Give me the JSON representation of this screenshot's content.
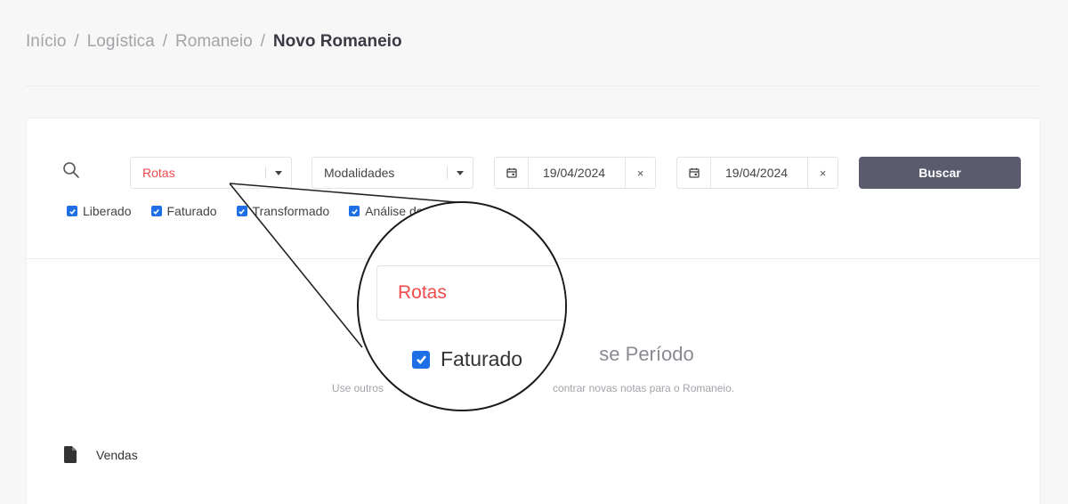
{
  "breadcrumb": {
    "items": [
      "Início",
      "Logística",
      "Romaneio"
    ],
    "separator": "/",
    "current": "Novo Romaneio"
  },
  "filters": {
    "rotas": {
      "value": "Rotas",
      "color": "#f04a4a"
    },
    "modalidades": {
      "value": "Modalidades"
    },
    "date_start": {
      "value": "19/04/2024",
      "clear": "×"
    },
    "date_end": {
      "value": "19/04/2024",
      "clear": "×"
    },
    "search_button": "Buscar",
    "checkboxes": [
      {
        "label": "Liberado",
        "checked": true
      },
      {
        "label": "Faturado",
        "checked": true
      },
      {
        "label": "Transformado",
        "checked": true
      },
      {
        "label": "Análise de",
        "checked": true
      }
    ]
  },
  "empty_state": {
    "title_fragment": "se Período",
    "subtitle_left": "Use outros",
    "subtitle_right": "contrar novas notas para o Romaneio."
  },
  "section": {
    "label": "Vendas",
    "icon": "document-icon"
  },
  "magnifier": {
    "select_value": "Rotas",
    "checkbox_label": "Faturado"
  },
  "colors": {
    "accent": "#1e6fe6",
    "button": "#5b5b6e",
    "rotas_text": "#f04a4a"
  }
}
